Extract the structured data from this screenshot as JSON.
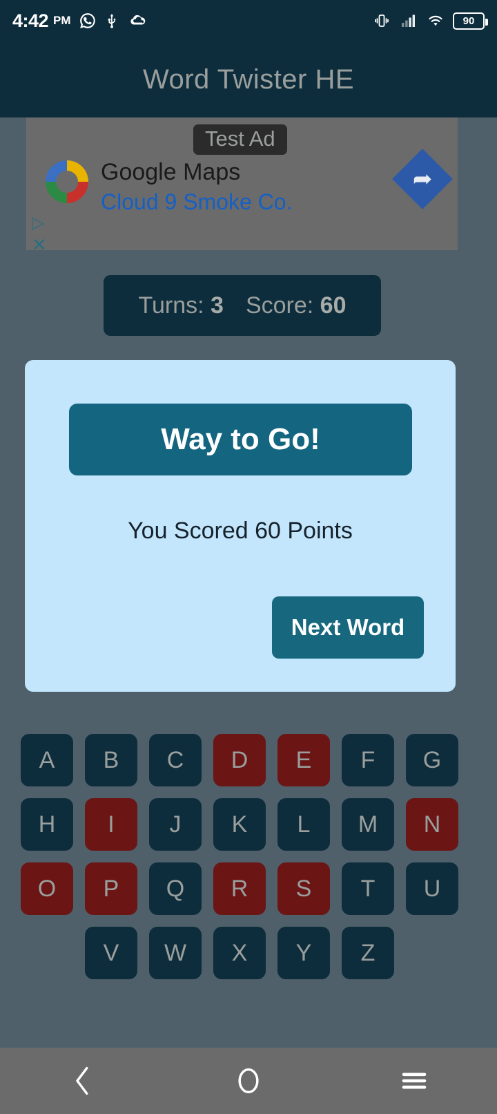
{
  "status_bar": {
    "time": "4:42",
    "ampm": "PM",
    "icons": [
      "whatsapp-icon",
      "usb-icon",
      "cloud-icon"
    ],
    "right_icons": [
      "vibrate-icon",
      "signal-icon",
      "wifi-icon"
    ],
    "battery_level": "90"
  },
  "app_bar": {
    "title": "Word Twister HE"
  },
  "ad": {
    "badge": "Test Ad",
    "advertiser": "Google Maps",
    "headline": "Cloud 9 Smoke Co.",
    "cta_icon": "turn-right-arrow-icon",
    "adchoices_icon": "adchoices-icon",
    "close_icon": "close-icon",
    "logo_icon": "google-maps-ring-icon"
  },
  "score_bar": {
    "turns_label": "Turns:",
    "turns_value": "3",
    "score_label": "Score:",
    "score_value": "60"
  },
  "dialog": {
    "banner_title": "Way to Go!",
    "message": "You Scored 60 Points",
    "button_label": "Next Word"
  },
  "keyboard": {
    "rows": [
      [
        {
          "letter": "A",
          "state": "unused"
        },
        {
          "letter": "B",
          "state": "unused"
        },
        {
          "letter": "C",
          "state": "unused"
        },
        {
          "letter": "D",
          "state": "used"
        },
        {
          "letter": "E",
          "state": "used"
        },
        {
          "letter": "F",
          "state": "unused"
        },
        {
          "letter": "G",
          "state": "unused"
        }
      ],
      [
        {
          "letter": "H",
          "state": "unused"
        },
        {
          "letter": "I",
          "state": "used"
        },
        {
          "letter": "J",
          "state": "unused"
        },
        {
          "letter": "K",
          "state": "unused"
        },
        {
          "letter": "L",
          "state": "unused"
        },
        {
          "letter": "M",
          "state": "unused"
        },
        {
          "letter": "N",
          "state": "used"
        }
      ],
      [
        {
          "letter": "O",
          "state": "used"
        },
        {
          "letter": "P",
          "state": "used"
        },
        {
          "letter": "Q",
          "state": "unused"
        },
        {
          "letter": "R",
          "state": "used"
        },
        {
          "letter": "S",
          "state": "used"
        },
        {
          "letter": "T",
          "state": "unused"
        },
        {
          "letter": "U",
          "state": "unused"
        }
      ],
      [
        {
          "letter": "V",
          "state": "unused"
        },
        {
          "letter": "W",
          "state": "unused"
        },
        {
          "letter": "X",
          "state": "unused"
        },
        {
          "letter": "Y",
          "state": "unused"
        },
        {
          "letter": "Z",
          "state": "unused"
        }
      ]
    ]
  },
  "nav_bar": {
    "back_icon": "back-chevron-icon",
    "home_icon": "home-circle-icon",
    "recents_icon": "menu-lines-icon"
  },
  "colors": {
    "app_bar": "#0e2d3c",
    "background": "#4f606a",
    "dialog_bg": "#c3e6fd",
    "accent": "#17687f",
    "key_unused": "#0e2d3c",
    "key_used": "#6b1515",
    "text_muted": "#9a9f9d"
  }
}
